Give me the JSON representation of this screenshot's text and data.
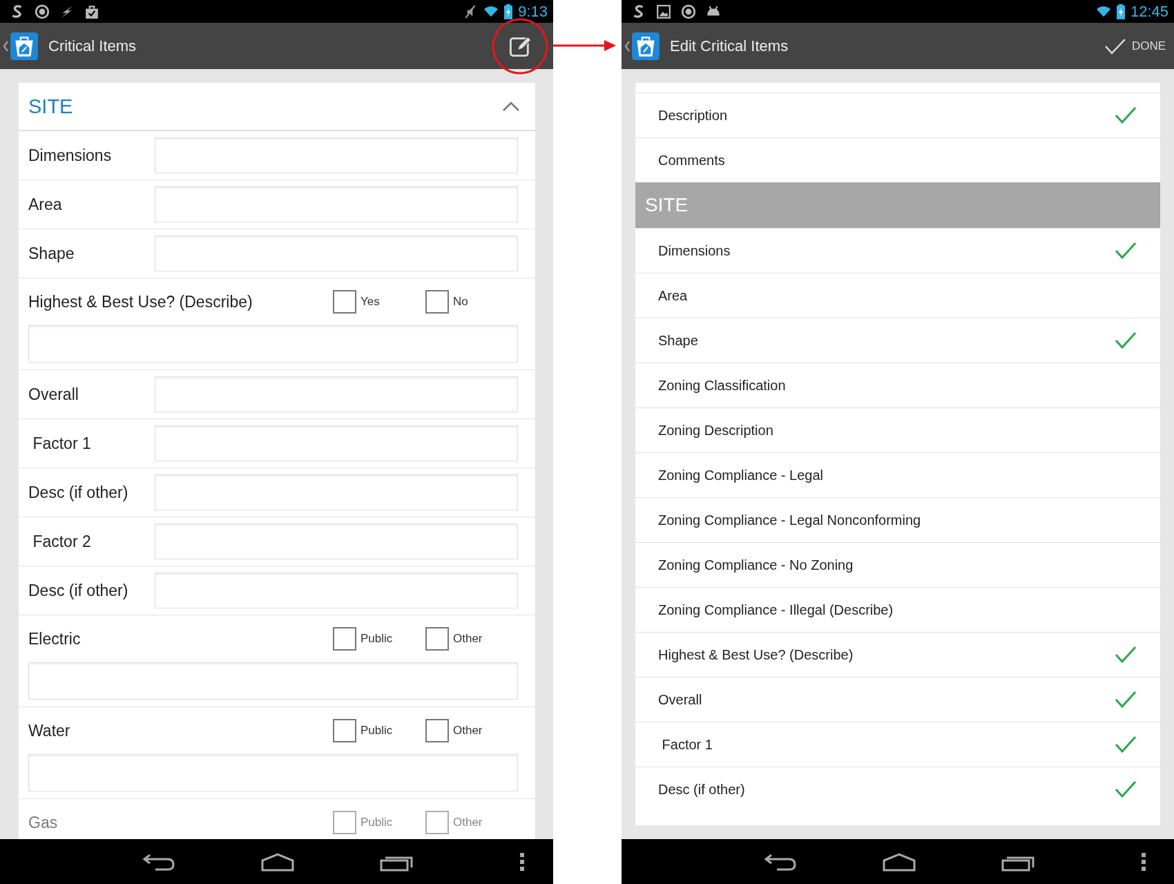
{
  "left_screen": {
    "status_bar": {
      "time": "9:13",
      "muted": true
    },
    "app_bar": {
      "title": "Critical Items"
    },
    "section": {
      "title": "SITE",
      "expanded": true
    },
    "fields": [
      {
        "kind": "text",
        "label": "Dimensions"
      },
      {
        "kind": "text",
        "label": "Area"
      },
      {
        "kind": "text",
        "label": "Shape"
      },
      {
        "kind": "choice",
        "label": "Highest & Best Use? (Describe)",
        "options": [
          {
            "label": "Yes",
            "checked": false
          },
          {
            "label": "No",
            "checked": false
          }
        ],
        "detail": true
      },
      {
        "kind": "text",
        "label": "Overall"
      },
      {
        "kind": "text",
        "label": " Factor 1"
      },
      {
        "kind": "text",
        "label": "Desc (if other)"
      },
      {
        "kind": "text",
        "label": " Factor 2"
      },
      {
        "kind": "text",
        "label": "Desc (if other)"
      },
      {
        "kind": "choice",
        "label": "Electric",
        "options": [
          {
            "label": "Public",
            "checked": false
          },
          {
            "label": "Other",
            "checked": false
          }
        ],
        "detail": true
      },
      {
        "kind": "choice",
        "label": "Water",
        "options": [
          {
            "label": "Public",
            "checked": false
          },
          {
            "label": "Other",
            "checked": false
          }
        ],
        "detail": true
      },
      {
        "kind": "choice",
        "label": "Gas",
        "options": [
          {
            "label": "Public",
            "checked": false
          },
          {
            "label": "Other",
            "checked": false
          }
        ],
        "detail": false
      }
    ]
  },
  "right_screen": {
    "status_bar": {
      "time": "12:45",
      "muted": false
    },
    "app_bar": {
      "title": "Edit Critical Items",
      "action": "DONE"
    },
    "items": [
      {
        "kind": "item",
        "label": "Description",
        "checked": true
      },
      {
        "kind": "item",
        "label": "Comments",
        "checked": false
      },
      {
        "kind": "header",
        "label": "SITE"
      },
      {
        "kind": "item",
        "label": "Dimensions",
        "checked": true
      },
      {
        "kind": "item",
        "label": "Area",
        "checked": false
      },
      {
        "kind": "item",
        "label": "Shape",
        "checked": true
      },
      {
        "kind": "item",
        "label": "Zoning Classification",
        "checked": false
      },
      {
        "kind": "item",
        "label": "Zoning Description",
        "checked": false
      },
      {
        "kind": "item",
        "label": "Zoning Compliance - Legal",
        "checked": false
      },
      {
        "kind": "item",
        "label": "Zoning Compliance - Legal Nonconforming",
        "checked": false
      },
      {
        "kind": "item",
        "label": "Zoning Compliance - No Zoning",
        "checked": false
      },
      {
        "kind": "item",
        "label": "Zoning Compliance - Illegal (Describe)",
        "checked": false
      },
      {
        "kind": "item",
        "label": "Highest & Best Use? (Describe)",
        "checked": true
      },
      {
        "kind": "item",
        "label": "Overall",
        "checked": true
      },
      {
        "kind": "item",
        "label": " Factor 1",
        "checked": true
      },
      {
        "kind": "item",
        "label": "Desc (if other)",
        "checked": true
      }
    ]
  }
}
